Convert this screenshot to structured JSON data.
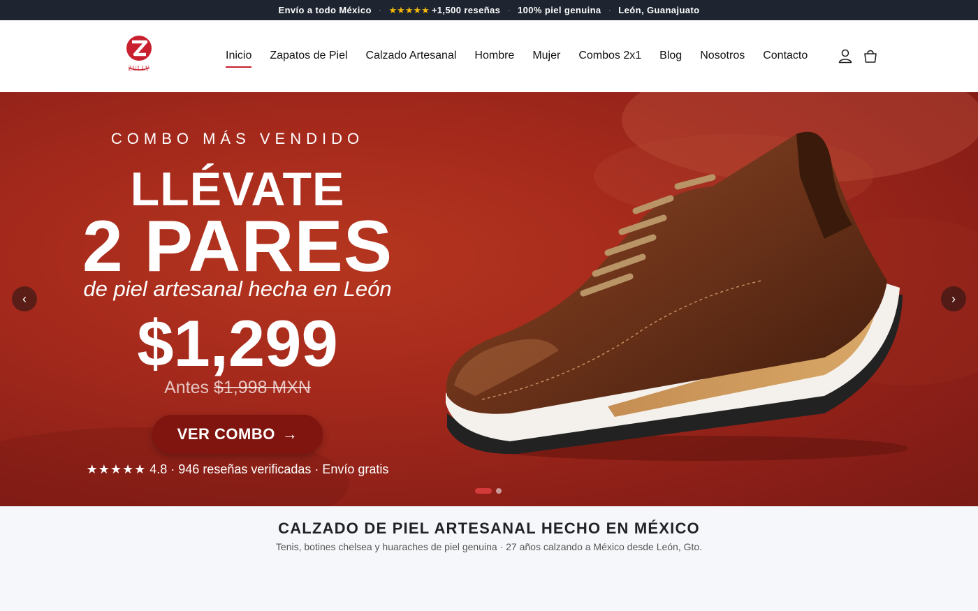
{
  "topbar": {
    "item1": "Envío a todo México",
    "stars": "★★★★★",
    "item2": "+1,500 reseñas",
    "item3": "100% piel genuina",
    "item4": "León, Guanajuato",
    "separator": "·"
  },
  "header": {
    "logo_letter": "Z",
    "logo_text": "ZULLY",
    "nav": [
      "Inicio",
      "Zapatos de Piel",
      "Calzado Artesanal",
      "Hombre",
      "Mujer",
      "Combos 2x1",
      "Blog",
      "Nosotros",
      "Contacto"
    ],
    "active_nav": "Inicio",
    "icons": [
      "user-icon",
      "shopping-bag-icon"
    ]
  },
  "hero": {
    "eyebrow": "COMBO MÁS VENDIDO",
    "headline_1": "LLÉVATE",
    "headline_2": "2 PARES",
    "subheadline": "de piel artesanal hecha en León",
    "price": "$1,299",
    "before_label": "Antes",
    "before_price": "$1,998 MXN",
    "cta_label": "VER COMBO",
    "cta_arrow": "→",
    "rating_stars": "★★★★★",
    "rating_text": "4.8 · 946 reseñas verificadas · Envío gratis",
    "prev_arrow": "‹",
    "next_arrow": "›",
    "slide_count": 2,
    "active_slide": 1
  },
  "section": {
    "title": "CALZADO DE PIEL ARTESANAL HECHO EN MÉXICO",
    "subtitle": "Tenis, botines chelsea y huaraches de piel genuina · 27 años calzando a México desde León, Gto."
  },
  "colors": {
    "brand_red": "#c8202f",
    "topbar_bg": "#1e2530",
    "hero_bg": "#a62a1c",
    "cta_bg": "#7f150e",
    "star_gold": "#f5b70a"
  }
}
